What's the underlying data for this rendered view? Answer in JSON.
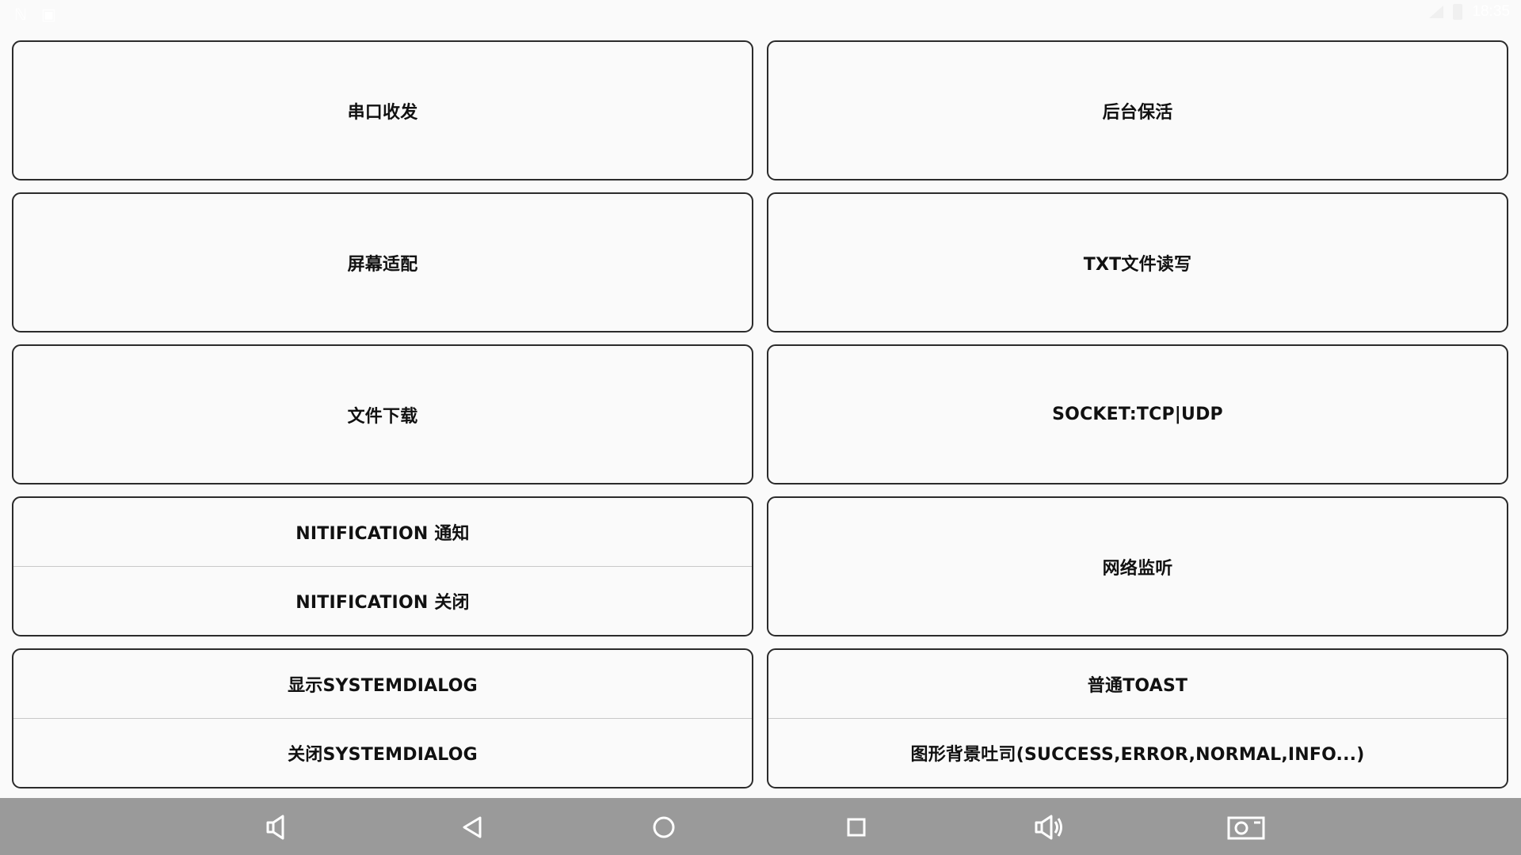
{
  "status_bar": {
    "left_icons": [
      "notification-n-icon",
      "notification-box-icon"
    ],
    "time": "18:35"
  },
  "cards": [
    [
      {
        "items": [
          "串口收发"
        ]
      },
      {
        "items": [
          "后台保活"
        ]
      }
    ],
    [
      {
        "items": [
          "屏幕适配"
        ]
      },
      {
        "items": [
          "TXT文件读写"
        ]
      }
    ],
    [
      {
        "items": [
          "文件下载"
        ]
      },
      {
        "items": [
          "SOCKET:TCP|UDP"
        ]
      }
    ],
    [
      {
        "items": [
          "NITIFICATION 通知",
          "NITIFICATION 关闭"
        ]
      },
      {
        "items": [
          "网络监听"
        ]
      }
    ],
    [
      {
        "items": [
          "显示SYSTEMDIALOG",
          "关闭SYSTEMDIALOG"
        ]
      },
      {
        "items": [
          "普通TOAST",
          "图形背景吐司(SUCCESS,ERROR,NORMAL,INFO...)"
        ]
      }
    ]
  ],
  "nav_bar": {
    "buttons": [
      "volume-down-icon",
      "back-icon",
      "home-icon",
      "recents-icon",
      "volume-up-icon",
      "screenshot-icon"
    ]
  },
  "colors": {
    "background": "#fafafa",
    "card_border": "#2b2b2b",
    "nav_bar": "#9a9a9a",
    "nav_icon": "#ffffff"
  }
}
